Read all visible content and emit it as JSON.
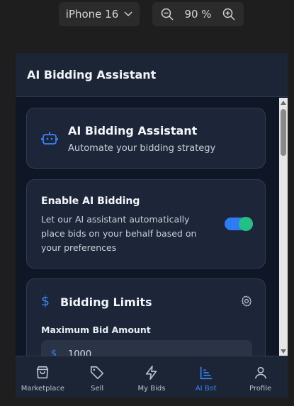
{
  "toolbar": {
    "device": "iPhone 16",
    "zoom": "90 %"
  },
  "header": {
    "title": "AI Bidding Assistant"
  },
  "assistant_card": {
    "title": "AI Bidding Assistant",
    "subtitle": "Automate your bidding strategy"
  },
  "enable_card": {
    "title": "Enable AI Bidding",
    "description": "Let our AI assistant automatically place bids on your behalf based on your preferences",
    "enabled": true
  },
  "limits_card": {
    "title": "Bidding Limits",
    "max_bid_label": "Maximum Bid Amount",
    "currency_symbol": "$",
    "max_bid_value": "1000"
  },
  "nav": [
    {
      "label": "Marketplace",
      "icon": "shopping-bag-icon"
    },
    {
      "label": "Sell",
      "icon": "tag-icon"
    },
    {
      "label": "My Bids",
      "icon": "lightning-icon"
    },
    {
      "label": "AI Bot",
      "icon": "chart-icon",
      "active": true
    },
    {
      "label": "Profile",
      "icon": "user-icon"
    }
  ],
  "colors": {
    "accent": "#3b82f6",
    "toggle_knob": "#22c082",
    "background": "#0f1726",
    "card": "#1c2638"
  }
}
